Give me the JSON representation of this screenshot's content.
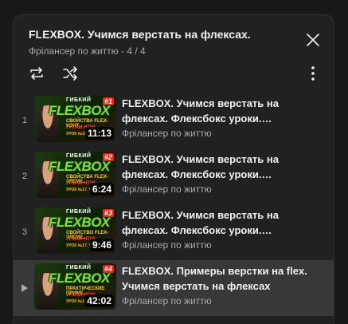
{
  "playlist": {
    "title": "FLEXBOX. Учимся верстать на флексах.",
    "channel": "Фрілансер по життю",
    "separator": " - ",
    "position": "4 / 4"
  },
  "items": [
    {
      "index": "1",
      "title": "FLEXBOX. Учимся верстать на флексах. Флексбокс уроки. Свойства flex-контейнера",
      "channel": "Фрілансер по життю",
      "duration": "11:13",
      "badge": "#1",
      "thumb_top": "ГИБКИЙ",
      "thumb_brand": "FLEXBOX",
      "thumb_line1": "СВОЙСТВА FLEX-КОНТ...",
      "thumb_line2": "УРОКИ HTML",
      "thumb_line3": "УРОК №15. ЧА"
    },
    {
      "index": "2",
      "title": "FLEXBOX. Учимся верстать на флексах. Флексбокс уроки. Свойства flex-элементов",
      "channel": "Фрілансер по життю",
      "duration": "6:24",
      "badge": "#2",
      "thumb_top": "ГИБКИЙ",
      "thumb_brand": "FLEXBOX",
      "thumb_line1": "СВОЙСТВА FLEX-ЭЛЕМЕ...",
      "thumb_line2": "УРОКИ HTML",
      "thumb_line3": "УРОК №17. ЧА"
    },
    {
      "index": "3",
      "title": "FLEXBOX. Учимся верстать на флексах. Флексбокс уроки. Свойство flex-элементов",
      "channel": "Фрілансер по життю",
      "duration": "9:46",
      "badge": "#3",
      "thumb_top": "ГИБКИЙ",
      "thumb_brand": "FLEXBOX",
      "thumb_line1": "СВОЙСТВО FLEX-ЭЛЕМЕ...",
      "thumb_line2": "УРОКИ HTML",
      "thumb_line3": "УРОК №17. ЧА"
    },
    {
      "index": "",
      "title": "FLEXBOX. Примеры верстки на flex. Учимся верстать на флексах",
      "channel": "Фрілансер по життю",
      "duration": "42:02",
      "badge": "#4",
      "thumb_top": "ГИБКИЙ",
      "thumb_brand": "FLEXBOX",
      "thumb_line1": "ПРАКТИЧЕСКИЕ ПРИМЕ...",
      "thumb_line2": "УРОКИ HTML",
      "thumb_line3": "УРОК №17. ЧА"
    }
  ],
  "icons": {
    "close": "close-icon",
    "loop": "loop-icon",
    "shuffle": "shuffle-icon",
    "more": "more-vert-icon",
    "now_playing": "play-arrow-icon"
  },
  "colors": {
    "panel_bg": "#212121",
    "page_bg": "#181818",
    "active_row": "#383838",
    "text_primary": "#f1f1f1",
    "text_secondary": "#aaaaaa"
  }
}
